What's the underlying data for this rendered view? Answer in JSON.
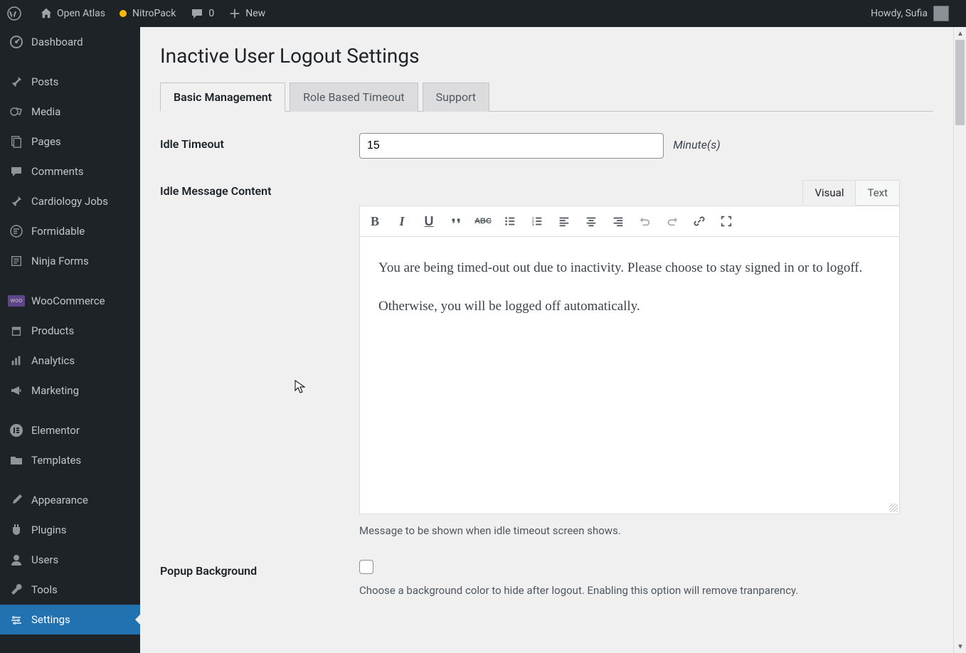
{
  "admin_bar": {
    "site_name": "Open Atlas",
    "nitropack_label": "NitroPack",
    "comments_count": "0",
    "new_label": "New",
    "howdy": "Howdy, Sufia"
  },
  "sidebar": {
    "items": [
      {
        "label": "Dashboard"
      },
      {
        "label": "Posts"
      },
      {
        "label": "Media"
      },
      {
        "label": "Pages"
      },
      {
        "label": "Comments"
      },
      {
        "label": "Cardiology Jobs"
      },
      {
        "label": "Formidable"
      },
      {
        "label": "Ninja Forms"
      },
      {
        "label": "WooCommerce"
      },
      {
        "label": "Products"
      },
      {
        "label": "Analytics"
      },
      {
        "label": "Marketing"
      },
      {
        "label": "Elementor"
      },
      {
        "label": "Templates"
      },
      {
        "label": "Appearance"
      },
      {
        "label": "Plugins"
      },
      {
        "label": "Users"
      },
      {
        "label": "Tools"
      },
      {
        "label": "Settings"
      }
    ]
  },
  "page": {
    "title": "Inactive User Logout Settings",
    "tabs": [
      {
        "label": "Basic Management",
        "active": true
      },
      {
        "label": "Role Based Timeout",
        "active": false
      },
      {
        "label": "Support",
        "active": false
      }
    ]
  },
  "form": {
    "idle_timeout": {
      "label": "Idle Timeout",
      "value": "15",
      "unit": "Minute(s)"
    },
    "idle_message": {
      "label": "Idle Message Content",
      "editor_tabs": {
        "visual": "Visual",
        "text": "Text"
      },
      "content_p1": "You are being timed-out out due to inactivity. Please choose to stay signed in or to logoff.",
      "content_p2": "Otherwise, you will be logged off automatically.",
      "help": "Message to be shown when idle timeout screen shows."
    },
    "popup_bg": {
      "label": "Popup Background",
      "help": "Choose a background color to hide after logout. Enabling this option will remove tranparency."
    }
  }
}
